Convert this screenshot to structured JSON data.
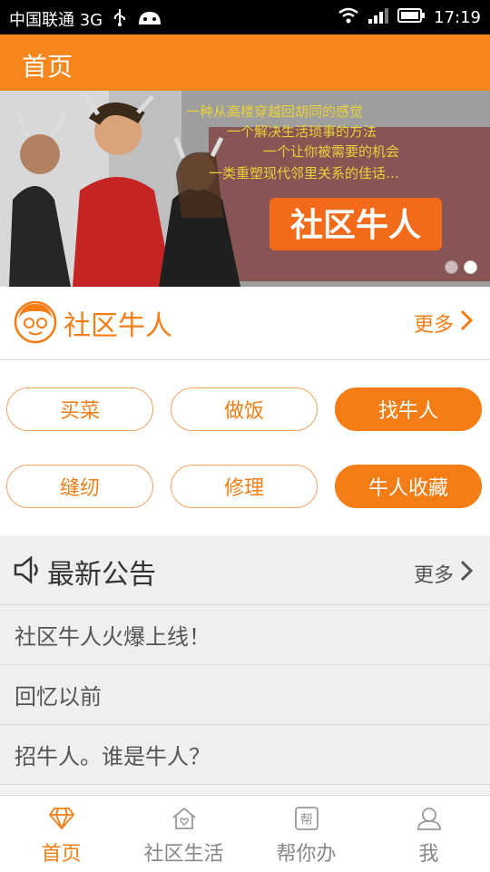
{
  "status_bar": {
    "carrier": "中国联通 3G",
    "time": "17:19"
  },
  "app_bar": {
    "title": "首页"
  },
  "banner": {
    "overlay_text": "社区牛人",
    "headline_lines": [
      "一种从高楼穿越回胡同的感觉",
      "一个解决生活琐事的方法",
      "一个让你被需要的机会",
      "一类重塑现代邻里关系的佳话…"
    ]
  },
  "community_section": {
    "title": "社区牛人",
    "more_label": "更多"
  },
  "categories": [
    {
      "label": "买菜",
      "filled": false
    },
    {
      "label": "做饭",
      "filled": false
    },
    {
      "label": "找牛人",
      "filled": true
    },
    {
      "label": "缝纫",
      "filled": false
    },
    {
      "label": "修理",
      "filled": false
    },
    {
      "label": "牛人收藏",
      "filled": true
    }
  ],
  "announcements": {
    "title": "最新公告",
    "more_label": "更多",
    "items": [
      "社区牛人火爆上线！",
      "回忆以前",
      "招牛人。谁是牛人？"
    ]
  },
  "bottom_nav": [
    {
      "label": "首页",
      "icon": "diamond-icon",
      "active": true
    },
    {
      "label": "社区生活",
      "icon": "house-heart-icon",
      "active": false
    },
    {
      "label": "帮你办",
      "icon": "help-badge-icon",
      "active": false
    },
    {
      "label": "我",
      "icon": "user-icon",
      "active": false
    }
  ],
  "colors": {
    "accent": "#f47d16",
    "appbar": "#f7861c",
    "background": "#efefef"
  }
}
